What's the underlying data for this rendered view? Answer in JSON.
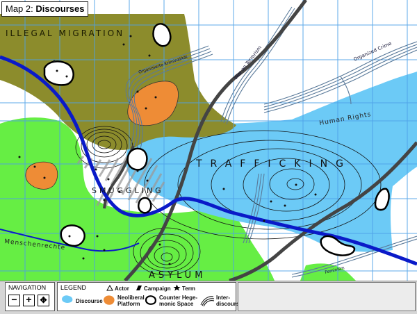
{
  "map": {
    "title_prefix": "Map 2:",
    "title_main": "Discourses",
    "regions": {
      "illegal_migration": "ILLEGAL MIGRATION",
      "smuggling": "SMUGGLING",
      "trafficking": "TRAFFICKING",
      "asylum": "ASYLUM",
      "human_rights": "Human Rights",
      "menschenrechte": "Menschenrechte"
    },
    "interdiscourses": {
      "war_on_terrorism": "War on Terrorism",
      "organized_crime": "Organized Crime",
      "organisierte_kriminalitaet": "Organisierte Kriminalität",
      "feminism": "Feminism"
    },
    "colors": {
      "illegal_migration": "#8c8c2c",
      "asylum_green": "#66ee44",
      "trafficking_blue": "#6ccaf6",
      "platform_orange": "#ee8c36",
      "grid": "#4da0e8",
      "interdiscourse_blue": "#0a1ac8"
    }
  },
  "navigation": {
    "title": "NAVIGATION",
    "zoom_out": "−",
    "zoom_in": "+",
    "pan": "✥"
  },
  "legend": {
    "title": "LEGEND",
    "items": {
      "actor": "Actor",
      "campaign": "Campaign",
      "term": "Term",
      "discourse": "Discourse",
      "neoliberal_1": "Neoliberal",
      "neoliberal_2": "Platform",
      "counter_1": "Counter Hege-",
      "counter_2": "monic Space",
      "inter_1": "Inter-",
      "inter_2": "discourse"
    }
  }
}
